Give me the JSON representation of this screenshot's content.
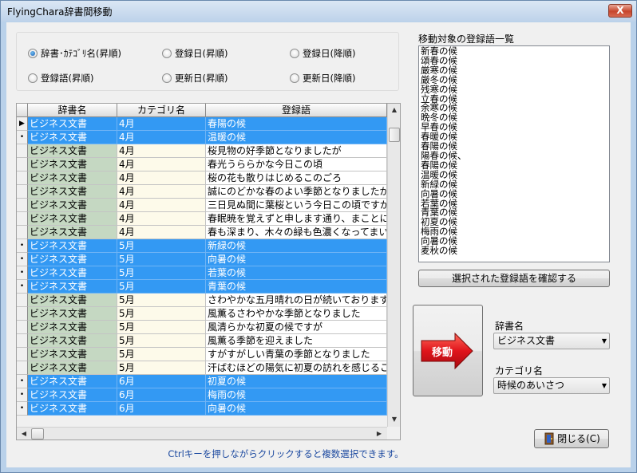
{
  "window": {
    "title": "FlyingChara辞書間移動",
    "close_glyph": "X"
  },
  "sort": {
    "options": [
      {
        "label": "辞書･ｶﾃｺﾞﾘ名(昇順)",
        "selected": true
      },
      {
        "label": "登録日(昇順)",
        "selected": false
      },
      {
        "label": "登録日(降順)",
        "selected": false
      },
      {
        "label": "登録語(昇順)",
        "selected": false
      },
      {
        "label": "更新日(昇順)",
        "selected": false
      },
      {
        "label": "更新日(降順)",
        "selected": false
      }
    ]
  },
  "grid": {
    "headers": [
      "辞書名",
      "カテゴリ名",
      "登録語"
    ],
    "rows": [
      {
        "indicator": "▶",
        "dict": "ビジネス文書",
        "category": "4月",
        "word": "春陽の候",
        "selected": true
      },
      {
        "indicator": "•",
        "dict": "ビジネス文書",
        "category": "4月",
        "word": "温暖の候",
        "selected": true
      },
      {
        "indicator": "",
        "dict": "ビジネス文書",
        "category": "4月",
        "word": "桜見物の好季節となりましたが",
        "selected": false
      },
      {
        "indicator": "",
        "dict": "ビジネス文書",
        "category": "4月",
        "word": "春光うららかな今日この頃",
        "selected": false
      },
      {
        "indicator": "",
        "dict": "ビジネス文書",
        "category": "4月",
        "word": "桜の花も散りはじめるこのごろ",
        "selected": false
      },
      {
        "indicator": "",
        "dict": "ビジネス文書",
        "category": "4月",
        "word": "誠にのどかな春のよい季節となりましたが",
        "selected": false
      },
      {
        "indicator": "",
        "dict": "ビジネス文書",
        "category": "4月",
        "word": "三日見ぬ間に葉桜という今日この頃ですが",
        "selected": false
      },
      {
        "indicator": "",
        "dict": "ビジネス文書",
        "category": "4月",
        "word": "春眠暁を覚えずと申します通り、まことに",
        "selected": false
      },
      {
        "indicator": "",
        "dict": "ビジネス文書",
        "category": "4月",
        "word": "春も深まり、木々の緑も色濃くなってまいり",
        "selected": false
      },
      {
        "indicator": "•",
        "dict": "ビジネス文書",
        "category": "5月",
        "word": "新緑の候",
        "selected": true
      },
      {
        "indicator": "•",
        "dict": "ビジネス文書",
        "category": "5月",
        "word": "向暑の候",
        "selected": true
      },
      {
        "indicator": "•",
        "dict": "ビジネス文書",
        "category": "5月",
        "word": "若葉の候",
        "selected": true
      },
      {
        "indicator": "•",
        "dict": "ビジネス文書",
        "category": "5月",
        "word": "青葉の候",
        "selected": true
      },
      {
        "indicator": "",
        "dict": "ビジネス文書",
        "category": "5月",
        "word": "さわやかな五月晴れの日が続いておりますが",
        "selected": false
      },
      {
        "indicator": "",
        "dict": "ビジネス文書",
        "category": "5月",
        "word": "風薫るさわやかな季節となりました",
        "selected": false
      },
      {
        "indicator": "",
        "dict": "ビジネス文書",
        "category": "5月",
        "word": "風清らかな初夏の候ですが",
        "selected": false
      },
      {
        "indicator": "",
        "dict": "ビジネス文書",
        "category": "5月",
        "word": "風薫る季節を迎えました",
        "selected": false
      },
      {
        "indicator": "",
        "dict": "ビジネス文書",
        "category": "5月",
        "word": "すがすがしい青葉の季節となりました",
        "selected": false
      },
      {
        "indicator": "",
        "dict": "ビジネス文書",
        "category": "5月",
        "word": "汗ばむほどの陽気に初夏の訪れを感じるこ",
        "selected": false
      },
      {
        "indicator": "•",
        "dict": "ビジネス文書",
        "category": "6月",
        "word": "初夏の候",
        "selected": true
      },
      {
        "indicator": "•",
        "dict": "ビジネス文書",
        "category": "6月",
        "word": "梅雨の候",
        "selected": true
      },
      {
        "indicator": "•",
        "dict": "ビジネス文書",
        "category": "6月",
        "word": "向暑の候",
        "selected": true
      }
    ]
  },
  "target_list": {
    "label": "移動対象の登録語一覧",
    "items": [
      "新春の候",
      "頌春の候",
      "厳寒の候",
      "厳冬の候",
      "残寒の候",
      "立春の候",
      "余寒の候",
      "晩冬の候",
      "早春の候",
      "春暖の候",
      "春陽の候",
      "陽春の候、",
      "春陽の候",
      "温暖の候",
      "新緑の候",
      "向暑の候",
      "若葉の候",
      "青葉の候",
      "初夏の候",
      "梅雨の候",
      "向暑の候",
      "麦秋の候"
    ]
  },
  "buttons": {
    "confirm_label": "選択された登録語を確認する",
    "move_label": "移動",
    "close_label": "閉じる(C)"
  },
  "dest": {
    "dict_label": "辞書名",
    "dict_value": "ビジネス文書",
    "category_label": "カテゴリ名",
    "category_value": "時候のあいさつ"
  },
  "hint": "Ctrlキーを押しながらクリックすると複数選択できます。",
  "colors": {
    "selection": "#3399f3",
    "dict_column": "#c5d8c2",
    "category_column": "#fdfaea",
    "move_button": "#e0141b"
  }
}
